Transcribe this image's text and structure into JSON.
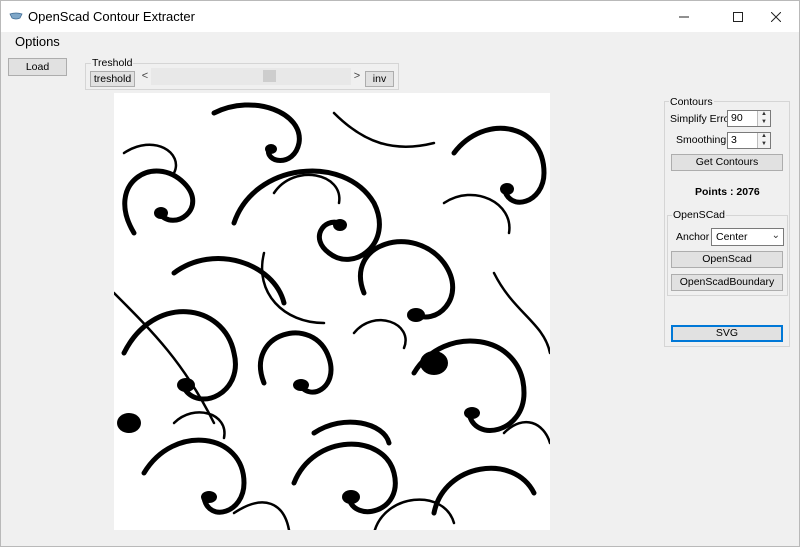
{
  "window": {
    "title": "OpenScad Contour Extracter"
  },
  "menu": {
    "options": "Options"
  },
  "toolbar": {
    "load_label": "Load"
  },
  "threshold": {
    "group_label": "Treshold",
    "button_label": "treshold",
    "left_arrow": "<",
    "right_arrow": ">",
    "inv_label": "inv",
    "slider_fraction": 0.6
  },
  "contours": {
    "group_label": "Contours",
    "simplify_label": "Simplify Error",
    "simplify_value": "90",
    "smoothing_label": "Smoothing",
    "smoothing_value": "3",
    "get_button": "Get Contours",
    "points_text": "Points : 2076"
  },
  "openscad": {
    "group_label": "OpenSCad",
    "anchor_label": "Anchor",
    "anchor_value": "Center",
    "openscad_button": "OpenScad",
    "boundary_button": "OpenScadBoundary"
  },
  "svg_button": "SVG",
  "icons": {
    "app": "app-logo-icon",
    "minimize": "minimize-icon",
    "maximize": "maximize-icon",
    "close": "close-icon"
  },
  "colors": {
    "window_bg": "#f0f0f0",
    "titlebar": "#ffffff",
    "button": "#e1e1e1",
    "svg_border": "#0078d7"
  }
}
